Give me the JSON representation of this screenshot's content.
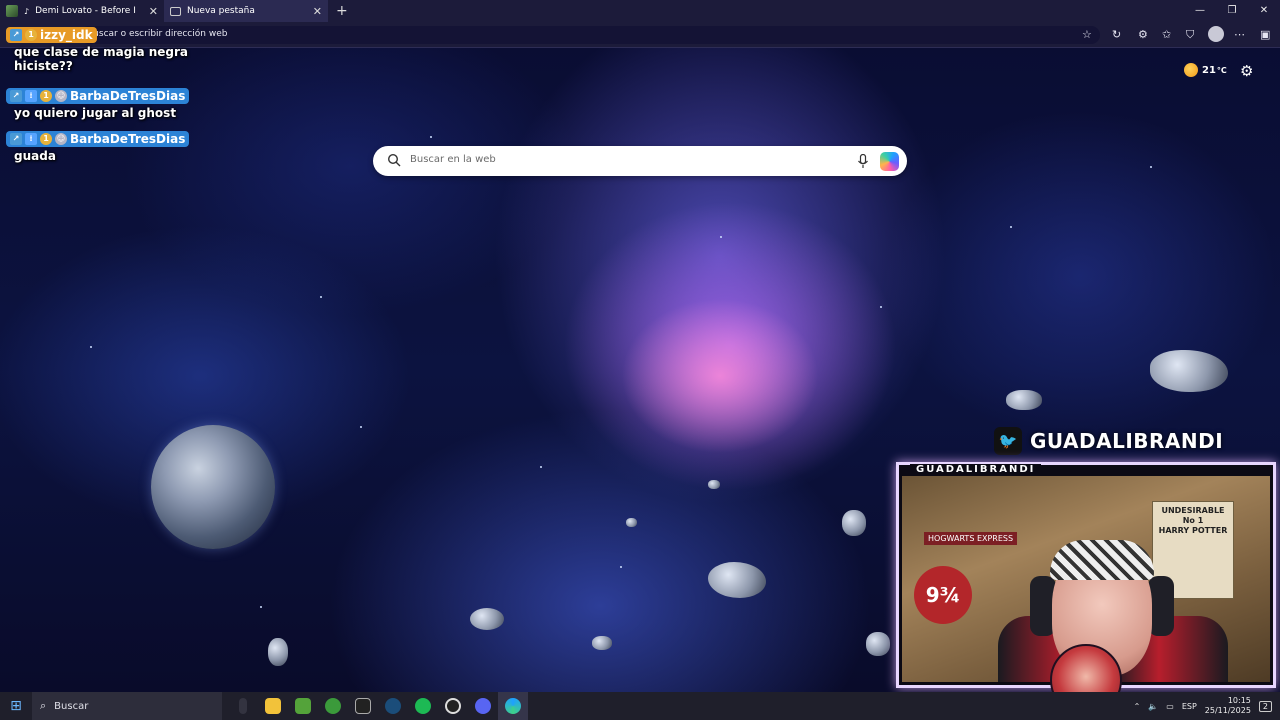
{
  "browser": {
    "tabs": [
      {
        "title": "Demi Lovato - Before I Knew",
        "active": false
      },
      {
        "title": "Nueva pestaña",
        "active": true
      }
    ],
    "address_placeholder": "Buscar o escribir dirección web"
  },
  "chat": [
    {
      "user": "izzy_idk",
      "color": "orange",
      "message": "que clase de magia negra hiciste??"
    },
    {
      "user": "BarbaDeTresDias",
      "color": "blue",
      "message": "yo quiero jugar al ghost"
    },
    {
      "user": "BarbaDeTresDias",
      "color": "blue",
      "message": "guada"
    }
  ],
  "weather": {
    "temp": "21",
    "unit": "°C"
  },
  "search": {
    "placeholder": "Buscar en la web"
  },
  "stream": {
    "twitter_handle": "GUADALIBRANDI",
    "cam_label": "GUADALIBRANDI",
    "poster_text": "UNDESIRABLE\nNo 1\nHARRY POTTER",
    "platform_sign": "9¾",
    "express_sign": "HOGWARTS EXPRESS"
  },
  "taskbar": {
    "search_label": "Buscar",
    "lang": "ESP",
    "time": "10:15",
    "date": "25/11/2025",
    "notifications": "2"
  }
}
